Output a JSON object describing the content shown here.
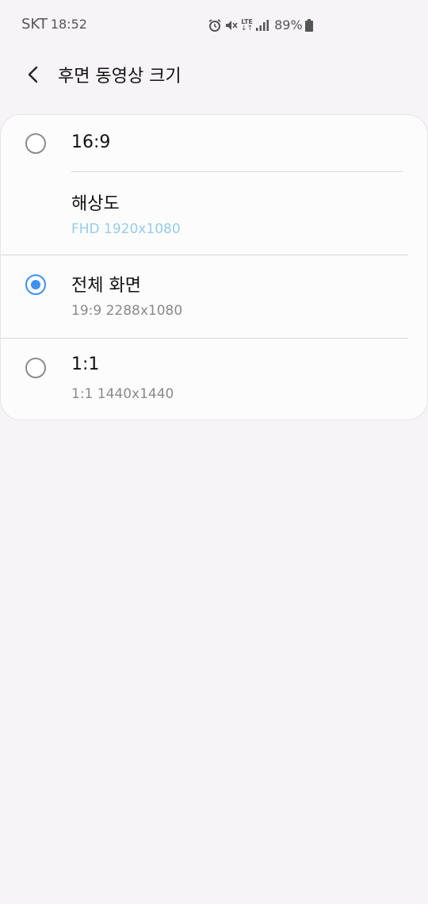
{
  "status_bar": {
    "carrier": "SKT",
    "time": "18:52",
    "network": "LTE",
    "battery": "89%"
  },
  "header": {
    "title": "후면 동영상 크기"
  },
  "options": [
    {
      "title": "16:9",
      "selected": false
    },
    {
      "title": "해상도",
      "subtitle": "FHD 1920x1080"
    },
    {
      "title": "전체 화면",
      "subtitle": "19:9 2288x1080",
      "selected": true
    },
    {
      "title": "1:1",
      "subtitle": "1:1 1440x1440",
      "selected": false
    }
  ],
  "colors": {
    "accent": "#3e91f0",
    "sub_blue": "#94ccea",
    "background": "#f6f4f6"
  }
}
